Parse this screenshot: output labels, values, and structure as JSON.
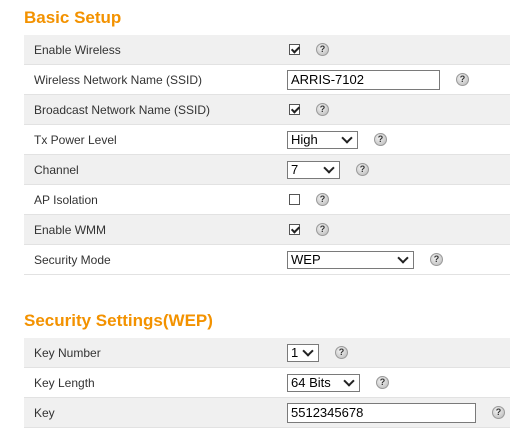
{
  "basic_setup": {
    "title": "Basic Setup",
    "enable_wireless_label": "Enable Wireless",
    "enable_wireless_checked": true,
    "ssid_label": "Wireless Network Name (SSID)",
    "ssid_value": "ARRIS-7102",
    "broadcast_label": "Broadcast Network Name (SSID)",
    "broadcast_checked": true,
    "tx_power_label": "Tx Power Level",
    "tx_power_value": "High",
    "channel_label": "Channel",
    "channel_value": "7",
    "ap_isolation_label": "AP Isolation",
    "ap_isolation_checked": false,
    "wmm_label": "Enable WMM",
    "wmm_checked": true,
    "security_mode_label": "Security Mode",
    "security_mode_value": "WEP"
  },
  "security_settings": {
    "title": "Security Settings(WEP)",
    "key_number_label": "Key Number",
    "key_number_value": "1",
    "key_length_label": "Key Length",
    "key_length_value": "64 Bits",
    "key_label": "Key",
    "key_value": "5512345678"
  },
  "help_glyph": "?",
  "icons": {
    "help": "help-icon",
    "dropdown": "chevron-down-icon"
  },
  "colors": {
    "title": "#f39200",
    "row_alt": "#f0f0f0"
  }
}
